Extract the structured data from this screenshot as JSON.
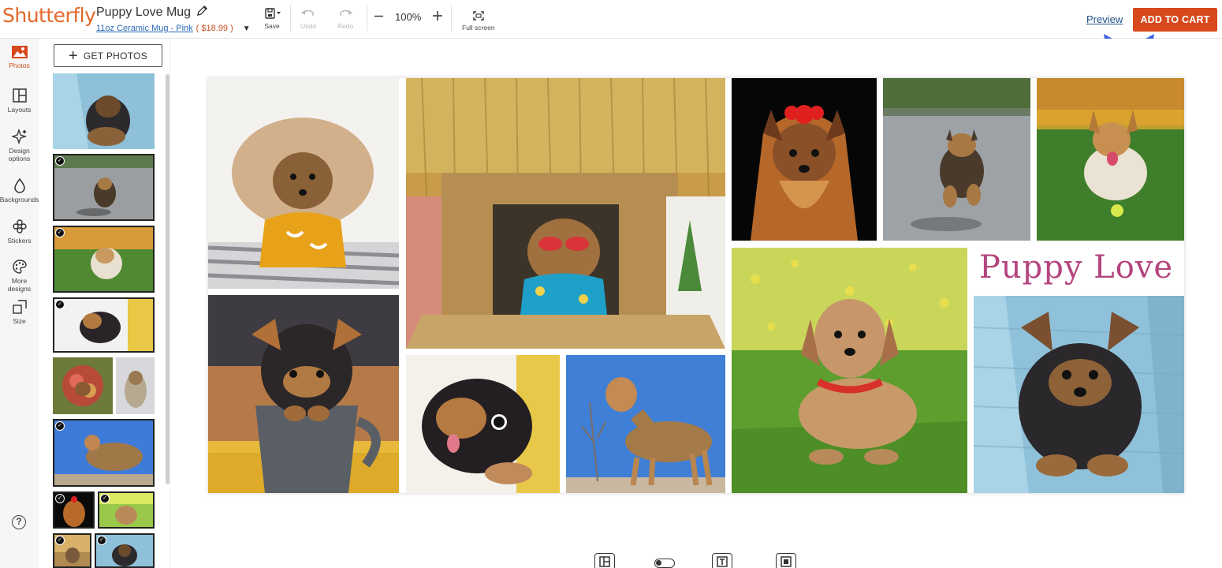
{
  "app": {
    "logo": "Shutterfly"
  },
  "project": {
    "title": "Puppy Love Mug",
    "product": "11oz Ceramic Mug - Pink",
    "price": "( $18.99 )"
  },
  "toolbar": {
    "save_label": "Save",
    "undo_label": "Undo",
    "redo_label": "Redo",
    "zoom_value": "100%",
    "fullscreen_label": "Full screen",
    "preview_label": "Preview",
    "cart_label": "ADD TO CART"
  },
  "sidebar": {
    "items": [
      {
        "label": "Photos",
        "icon": "photo-icon"
      },
      {
        "label": "Layouts",
        "icon": "layout-icon"
      },
      {
        "label": "Design options",
        "icon": "sparkle-icon"
      },
      {
        "label": "Backgrounds",
        "icon": "drop-icon"
      },
      {
        "label": "Stickers",
        "icon": "sticker-icon"
      },
      {
        "label": "More designs",
        "icon": "palette-icon"
      },
      {
        "label": "Size",
        "icon": "size-icon"
      }
    ],
    "help": "?"
  },
  "tray": {
    "get_photos_label": "GET PHOTOS"
  },
  "canvas": {
    "caption": "Puppy Love"
  },
  "colors": {
    "brand": "#e4682a",
    "cart_button": "#d7481c",
    "caption_text": "#b4447e",
    "annotation_arrow": "#3a5fe0"
  }
}
